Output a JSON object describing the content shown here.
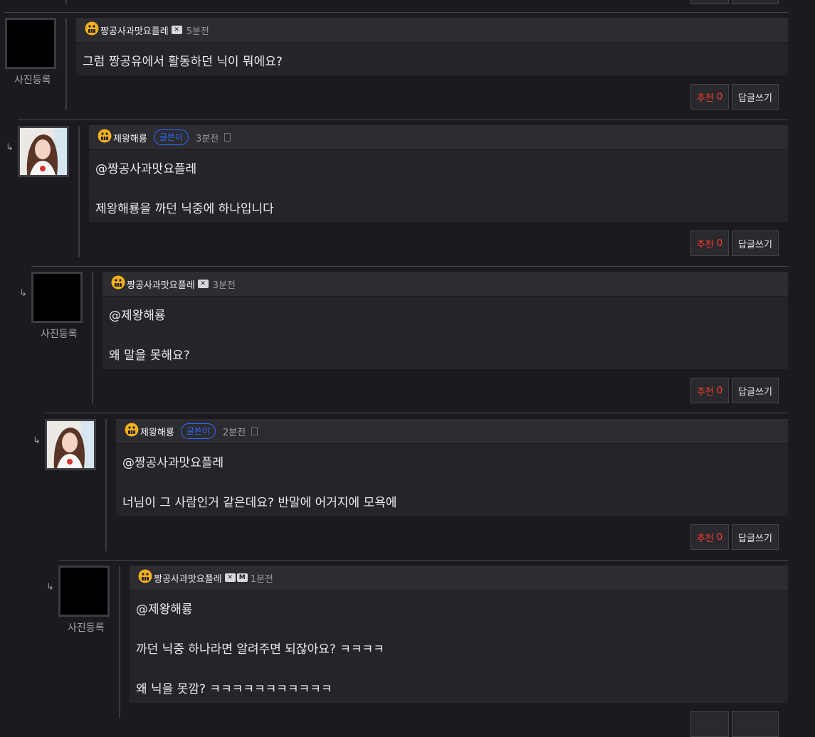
{
  "labels": {
    "photo_register": "사진등록",
    "author": "글쓴이",
    "recommend": "추천",
    "reply": "답글쓰기"
  },
  "badges": {
    "x": "✕",
    "m": "M"
  },
  "comments": [
    {
      "nick": "짱공사과맛요플레",
      "time": "5분전",
      "lines": [
        "그럼 짱공유에서 활동하던 닉이 뭐에요?"
      ],
      "recommend_count": "0"
    },
    {
      "nick": "제왕해룡",
      "time": "3분전",
      "lines": [
        "@짱공사과맛요플레",
        "제왕해룡을 까던 닉중에 하나입니다"
      ],
      "recommend_count": "0"
    },
    {
      "nick": "짱공사과맛요플레",
      "time": "3분전",
      "lines": [
        "@제왕해룡",
        "왜 말을 못해요?"
      ],
      "recommend_count": "0"
    },
    {
      "nick": "제왕해룡",
      "time": "2분전",
      "lines": [
        "@짱공사과맛요플레",
        "너님이 그 사람인거 같은데요? 반말에 어거지에 모욕에"
      ],
      "recommend_count": "0"
    },
    {
      "nick": "짱공사과맛요플레",
      "time": "1분전",
      "lines": [
        "@제왕해룡",
        "까던 닉중 하나라면 알려주면 되잖아요? ㅋㅋㅋㅋ",
        "왜 닉을 못깜? ㅋㅋㅋㅋㅋㅋㅋㅋㅋㅋㅋ"
      ],
      "recommend_count": ""
    }
  ],
  "colors": {
    "recommend": "#ff3b2f",
    "author_badge": "#2f6bff",
    "level_icon": "#f2b01e"
  },
  "icons": {
    "level": "level-face-icon",
    "reply_arrow": "reply-arrow-icon",
    "doc": "doc-icon"
  }
}
